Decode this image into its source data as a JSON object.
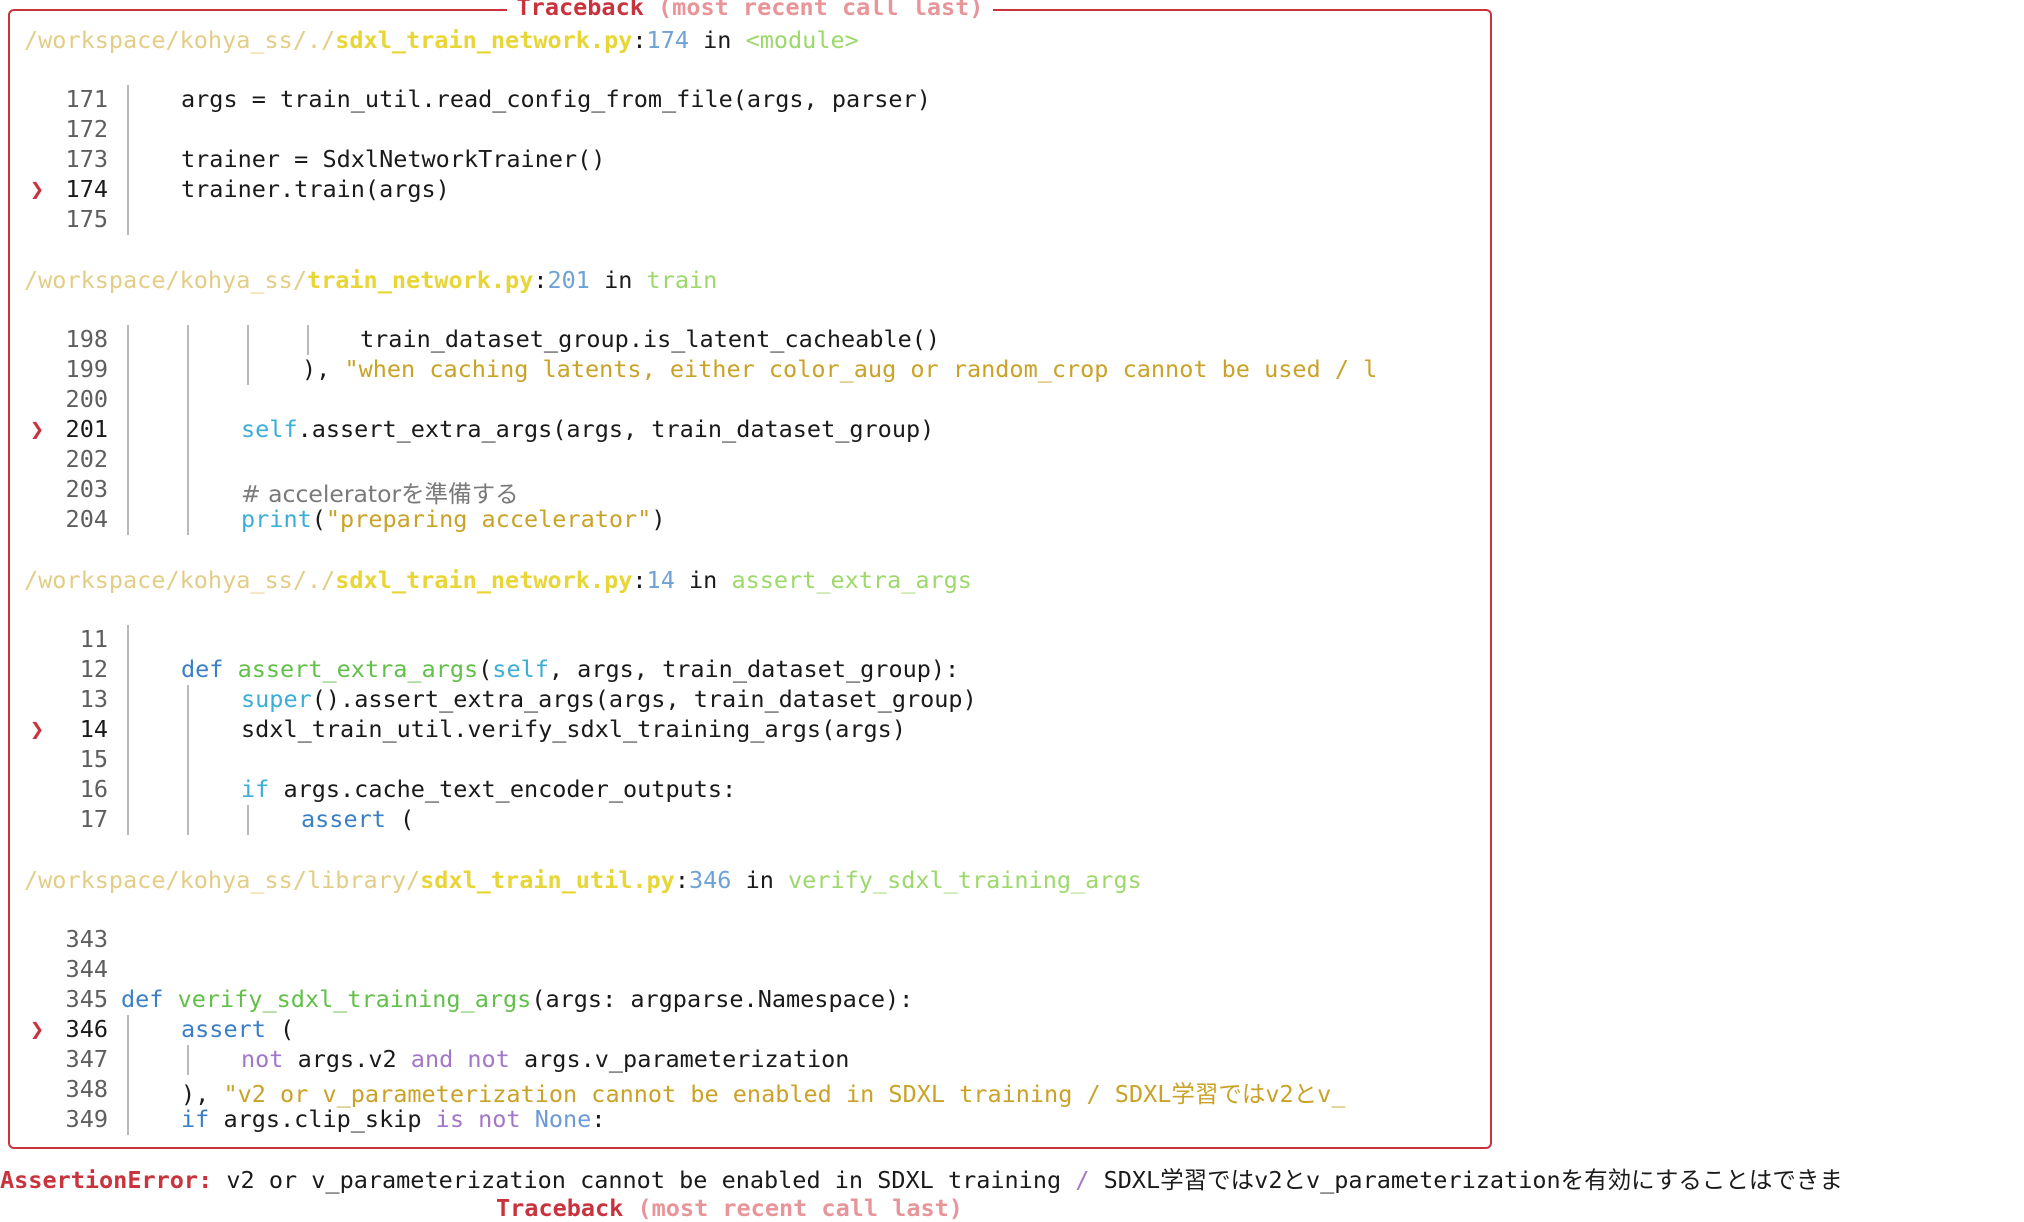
{
  "traceback": {
    "title_main": "Traceback",
    "title_sub": "(most recent call last)",
    "frames": [
      {
        "path_prefix": "/workspace/kohya_ss/./",
        "file": "sdxl_train_network.py",
        "sep": ":",
        "line": "174",
        "in_word": " in ",
        "func": "<module>",
        "lines": [
          {
            "no": "171",
            "current": false
          },
          {
            "no": "172",
            "current": false
          },
          {
            "no": "173",
            "current": false
          },
          {
            "no": "174",
            "current": true
          },
          {
            "no": "175",
            "current": false
          }
        ],
        "code": [
          {
            "t1": "args = train_util.read_config_from_file(args, parser)"
          },
          {
            "t1": ""
          },
          {
            "t1": "trainer = SdxlNetworkTrainer()"
          },
          {
            "t1": "trainer.train(args)"
          },
          {
            "t1": ""
          }
        ]
      },
      {
        "path_prefix": "/workspace/kohya_ss/",
        "file": "train_network.py",
        "sep": ":",
        "line": "201",
        "in_word": " in ",
        "func": "train",
        "lines": [
          {
            "no": "198",
            "current": false
          },
          {
            "no": "199",
            "current": false
          },
          {
            "no": "200",
            "current": false
          },
          {
            "no": "201",
            "current": true
          },
          {
            "no": "202",
            "current": false
          },
          {
            "no": "203",
            "current": false
          },
          {
            "no": "204",
            "current": false
          }
        ],
        "code": [
          {
            "t1": "train_dataset_group.is_latent_cacheable()"
          },
          {
            "t1": "), ",
            "t2": "\"when caching latents, either color_aug or random_crop cannot be used / l"
          },
          {
            "t1": ""
          },
          {
            "t1": "self",
            "t2": ".assert_extra_args(args, train_dataset_group)"
          },
          {
            "t1": ""
          },
          {
            "t1": "# acceleratorを準備する"
          },
          {
            "t1": "print",
            "t2": "(",
            "t3": "\"preparing accelerator\"",
            "t4": ")"
          }
        ]
      },
      {
        "path_prefix": "/workspace/kohya_ss/./",
        "file": "sdxl_train_network.py",
        "sep": ":",
        "line": "14",
        "in_word": " in ",
        "func": "assert_extra_args",
        "lines": [
          {
            "no": "11",
            "current": false
          },
          {
            "no": "12",
            "current": false
          },
          {
            "no": "13",
            "current": false
          },
          {
            "no": "14",
            "current": true
          },
          {
            "no": "15",
            "current": false
          },
          {
            "no": "16",
            "current": false
          },
          {
            "no": "17",
            "current": false
          }
        ],
        "code": [
          {
            "t1": ""
          },
          {
            "t1": "def",
            "t2": " ",
            "t3": "assert_extra_args",
            "t4": "(",
            "t5": "self",
            "t6": ", args, train_dataset_group):"
          },
          {
            "t1": "super",
            "t2": "().assert_extra_args(args, train_dataset_group)"
          },
          {
            "t1": "sdxl_train_util.verify_sdxl_training_args(args)"
          },
          {
            "t1": ""
          },
          {
            "t1": "if",
            "t2": " args.cache_text_encoder_outputs:"
          },
          {
            "t1": "assert",
            "t2": " ("
          }
        ]
      },
      {
        "path_prefix": "/workspace/kohya_ss/library/",
        "file": "sdxl_train_util.py",
        "sep": ":",
        "line": "346",
        "in_word": " in ",
        "func": "verify_sdxl_training_args",
        "lines": [
          {
            "no": "343",
            "current": false
          },
          {
            "no": "344",
            "current": false
          },
          {
            "no": "345",
            "current": false
          },
          {
            "no": "346",
            "current": true
          },
          {
            "no": "347",
            "current": false
          },
          {
            "no": "348",
            "current": false
          },
          {
            "no": "349",
            "current": false
          }
        ],
        "code": [
          {
            "t1": ""
          },
          {
            "t1": ""
          },
          {
            "t1": "def",
            "t2": " ",
            "t3": "verify_sdxl_training_args",
            "t4": "(args: argparse.Namespace):"
          },
          {
            "t1": "assert",
            "t2": " ("
          },
          {
            "t1": "not",
            "t2": " args.v2 ",
            "t3": "and",
            "t4": " ",
            "t5": "not",
            "t6": " args.v_parameterization"
          },
          {
            "t1": "), ",
            "t2": "\"v2 or v_parameterization cannot be enabled in SDXL training / SDXL学習ではv2とv_"
          },
          {
            "t1": "if",
            "t2": " args.clip_skip ",
            "t3": "is",
            "t4": " ",
            "t5": "not",
            "t6": " ",
            "t7": "None",
            "t8": ":"
          }
        ]
      }
    ],
    "arrow_glyph": "❯"
  },
  "error": {
    "name": "AssertionError:",
    "message_a": " v2 or v_parameterization cannot be enabled in SDXL training ",
    "slash": "/",
    "message_b": " SDXL学習ではv2とv_parameterizationを有効にすることはできま"
  }
}
